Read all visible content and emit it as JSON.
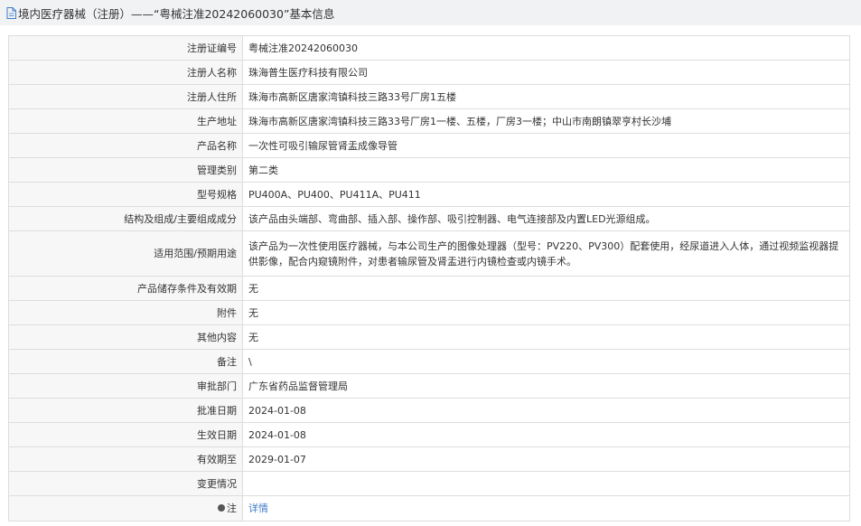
{
  "header": {
    "title": "境内医疗器械（注册）——“粤械注准20242060030”基本信息",
    "icon": "document-icon"
  },
  "rows": [
    {
      "label": "注册证编号",
      "value": "粤械注准20242060030"
    },
    {
      "label": "注册人名称",
      "value": "珠海普生医疗科技有限公司"
    },
    {
      "label": "注册人住所",
      "value": "珠海市高新区唐家湾镇科技三路33号厂房1五楼"
    },
    {
      "label": "生产地址",
      "value": "珠海市高新区唐家湾镇科技三路33号厂房1一楼、五楼，厂房3一楼；中山市南朗镇翠亨村长沙埔"
    },
    {
      "label": "产品名称",
      "value": "一次性可吸引输尿管肾盂成像导管"
    },
    {
      "label": "管理类别",
      "value": "第二类"
    },
    {
      "label": "型号规格",
      "value": "PU400A、PU400、PU411A、PU411"
    },
    {
      "label": "结构及组成/主要组成成分",
      "value": "该产品由头端部、弯曲部、插入部、操作部、吸引控制器、电气连接部及内置LED光源组成。"
    },
    {
      "label": "适用范围/预期用途",
      "value": "该产品为一次性使用医疗器械，与本公司生产的图像处理器（型号：PV220、PV300）配套使用，经尿道进入人体，通过视频监视器提供影像，配合内窥镜附件，对患者输尿管及肾盂进行内镜检查或内镜手术。"
    },
    {
      "label": "产品储存条件及有效期",
      "value": "无"
    },
    {
      "label": "附件",
      "value": "无"
    },
    {
      "label": "其他内容",
      "value": "无"
    },
    {
      "label": "备注",
      "value": "\\"
    },
    {
      "label": "审批部门",
      "value": "广东省药品监督管理局"
    },
    {
      "label": "批准日期",
      "value": "2024-01-08"
    },
    {
      "label": "生效日期",
      "value": "2024-01-08"
    },
    {
      "label": "有效期至",
      "value": "2029-01-07"
    },
    {
      "label": "变更情况",
      "value": ""
    }
  ],
  "note": {
    "label": "注",
    "icon": "bulb-icon",
    "link": "详情"
  }
}
